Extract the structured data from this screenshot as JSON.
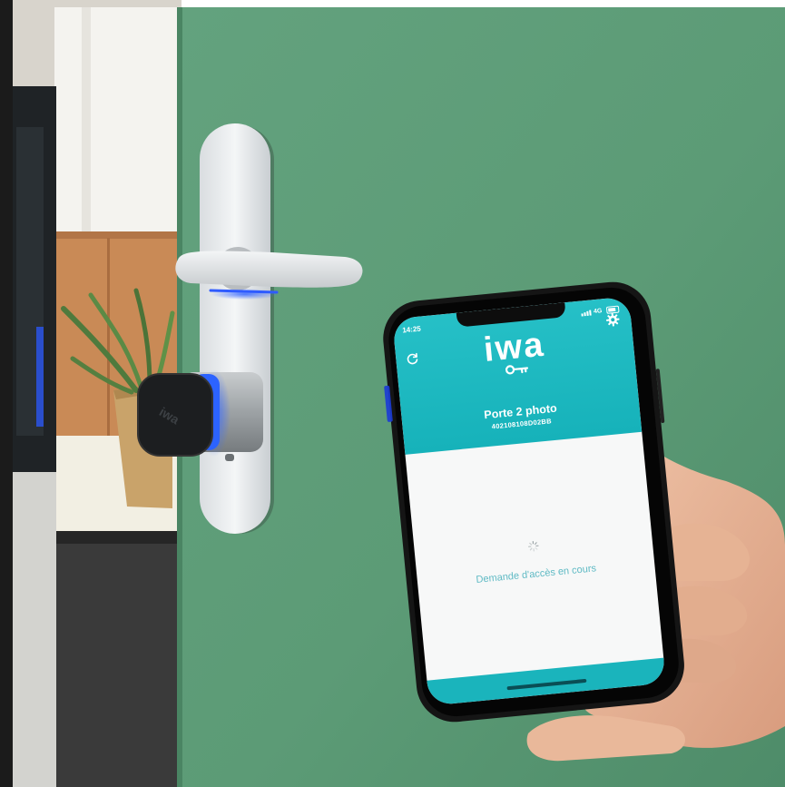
{
  "phone_app": {
    "status_time": "14:25",
    "status_network": "4G",
    "logo_text": "iwa",
    "door_name": "Porte 2 photo",
    "door_id": "402108108D02BB",
    "access_status": "Demande d'accès en cours",
    "icons": [
      "refresh-icon",
      "gear-icon",
      "key-icon",
      "spinner-icon"
    ]
  },
  "colors": {
    "app_teal": "#1ab4bc",
    "door_green": "#5f9c78",
    "led_blue": "#2f5bff"
  }
}
